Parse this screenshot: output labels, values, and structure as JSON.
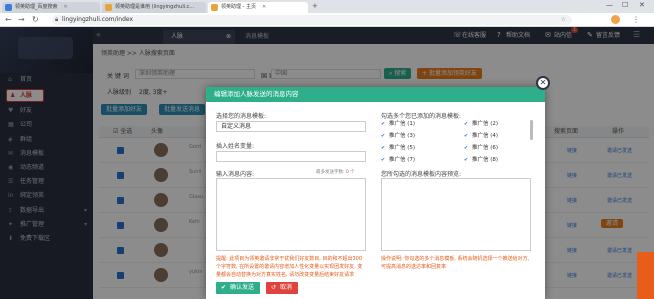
{
  "browser": {
    "tabs": [
      {
        "title": "领英助理_百度搜索",
        "active": false
      },
      {
        "title": "领英助理是谁用 (lingyingzhuli.c...",
        "active": false
      },
      {
        "title": "领英助理 - 主页",
        "active": true
      }
    ],
    "url": "lingyingzhuli.com/index"
  },
  "sidebar": {
    "items": [
      {
        "label": "首页",
        "icon": "home-icon"
      },
      {
        "label": "人脉",
        "icon": "person-icon",
        "active": true
      },
      {
        "label": "好友",
        "icon": "friends-icon"
      },
      {
        "label": "公司",
        "icon": "building-icon"
      },
      {
        "label": "群组",
        "icon": "group-icon"
      },
      {
        "label": "消息模板",
        "icon": "message-icon"
      },
      {
        "label": "动态频道",
        "icon": "feed-icon"
      },
      {
        "label": "任务管理",
        "icon": "task-icon"
      },
      {
        "label": "绑定领英",
        "icon": "link-icon"
      },
      {
        "label": "数据导出",
        "icon": "export-icon",
        "arrow": true
      },
      {
        "label": "推广管理",
        "icon": "promo-icon",
        "arrow": true
      },
      {
        "label": "免费下载区",
        "icon": "download-icon"
      }
    ]
  },
  "header": {
    "tabs": [
      {
        "label": "人脉",
        "active": true
      },
      {
        "label": "消息模板",
        "active": false
      }
    ],
    "actions": [
      {
        "label": "在线客服",
        "icon": "chat-icon"
      },
      {
        "label": "帮助文档",
        "icon": "help-icon"
      },
      {
        "label": "站内信",
        "icon": "mail-icon",
        "badge": "1"
      },
      {
        "label": "留言反馈",
        "icon": "feedback-icon"
      }
    ]
  },
  "main": {
    "breadcrumb": "领英助理 >> 人脉搜索页面",
    "keyword_label": "关 键 词",
    "keyword_value": "深圳领英助理",
    "region_label": "国    家",
    "region_value": "中国",
    "level_label": "人脉级别",
    "level_value": "2度, 3度+",
    "search_button": "搜索",
    "import_button": "+ 批量添加领英好友",
    "batch_add_button": "批量添加好友",
    "batch_msg_button": "批量发送消息",
    "select_all": "全选",
    "columns": [
      "全选",
      "头像",
      "",
      "搜索页面",
      "操作"
    ],
    "row_names": [
      "Gord",
      "Sunil",
      "Glasu",
      "Kehi",
      "",
      "",
      "yukin"
    ],
    "row_link": "链接",
    "row_action": "邀请已发送",
    "row_action_alt": "邀请"
  },
  "modal": {
    "title": "编辑添加人脉发送的消息内容",
    "choose_template_label": "选择您的消息模板:",
    "choose_template_value": "自定义消息",
    "insert_name_label": "插入姓名变量:",
    "enter_message_label": "输入消息内容:",
    "char_count_label": "最多发送字数:",
    "char_count_value": "0",
    "char_unit": "个",
    "tick_templates_label": "勾选多个您已添加的消息模板:",
    "templates": [
      "推广信 (1)",
      "推广信 (2)",
      "推广信 (3)",
      "推广信 (4)",
      "推广信 (5)",
      "推广信 (6)",
      "推广信 (7)",
      "推广信 (8)"
    ],
    "preview_label": "您所勾选的消息模板内容预览:",
    "left_note": "提醒: 此项目为领英邀请非常干扰我们好友数目, 目的和不超出300个字符数, 在所设置的邀请内容增加人性化变量以实现团发好友, 变量都会自动替换为对方真实姓名, 请勿改变变量后结束好友请求",
    "right_note": "操作说明: 你勾选的多个消息模板, 系统会随机选择一个推送给对方, 可提高消息的送达率和回复率",
    "confirm_button": "确认发送",
    "cancel_button": "取消"
  },
  "colors": {
    "accent_green": "#2fae8c",
    "sidebar_bg": "#2b3040",
    "header_bg": "#2f3546",
    "note_orange": "#e25c1a",
    "danger_red": "#e0433d"
  }
}
